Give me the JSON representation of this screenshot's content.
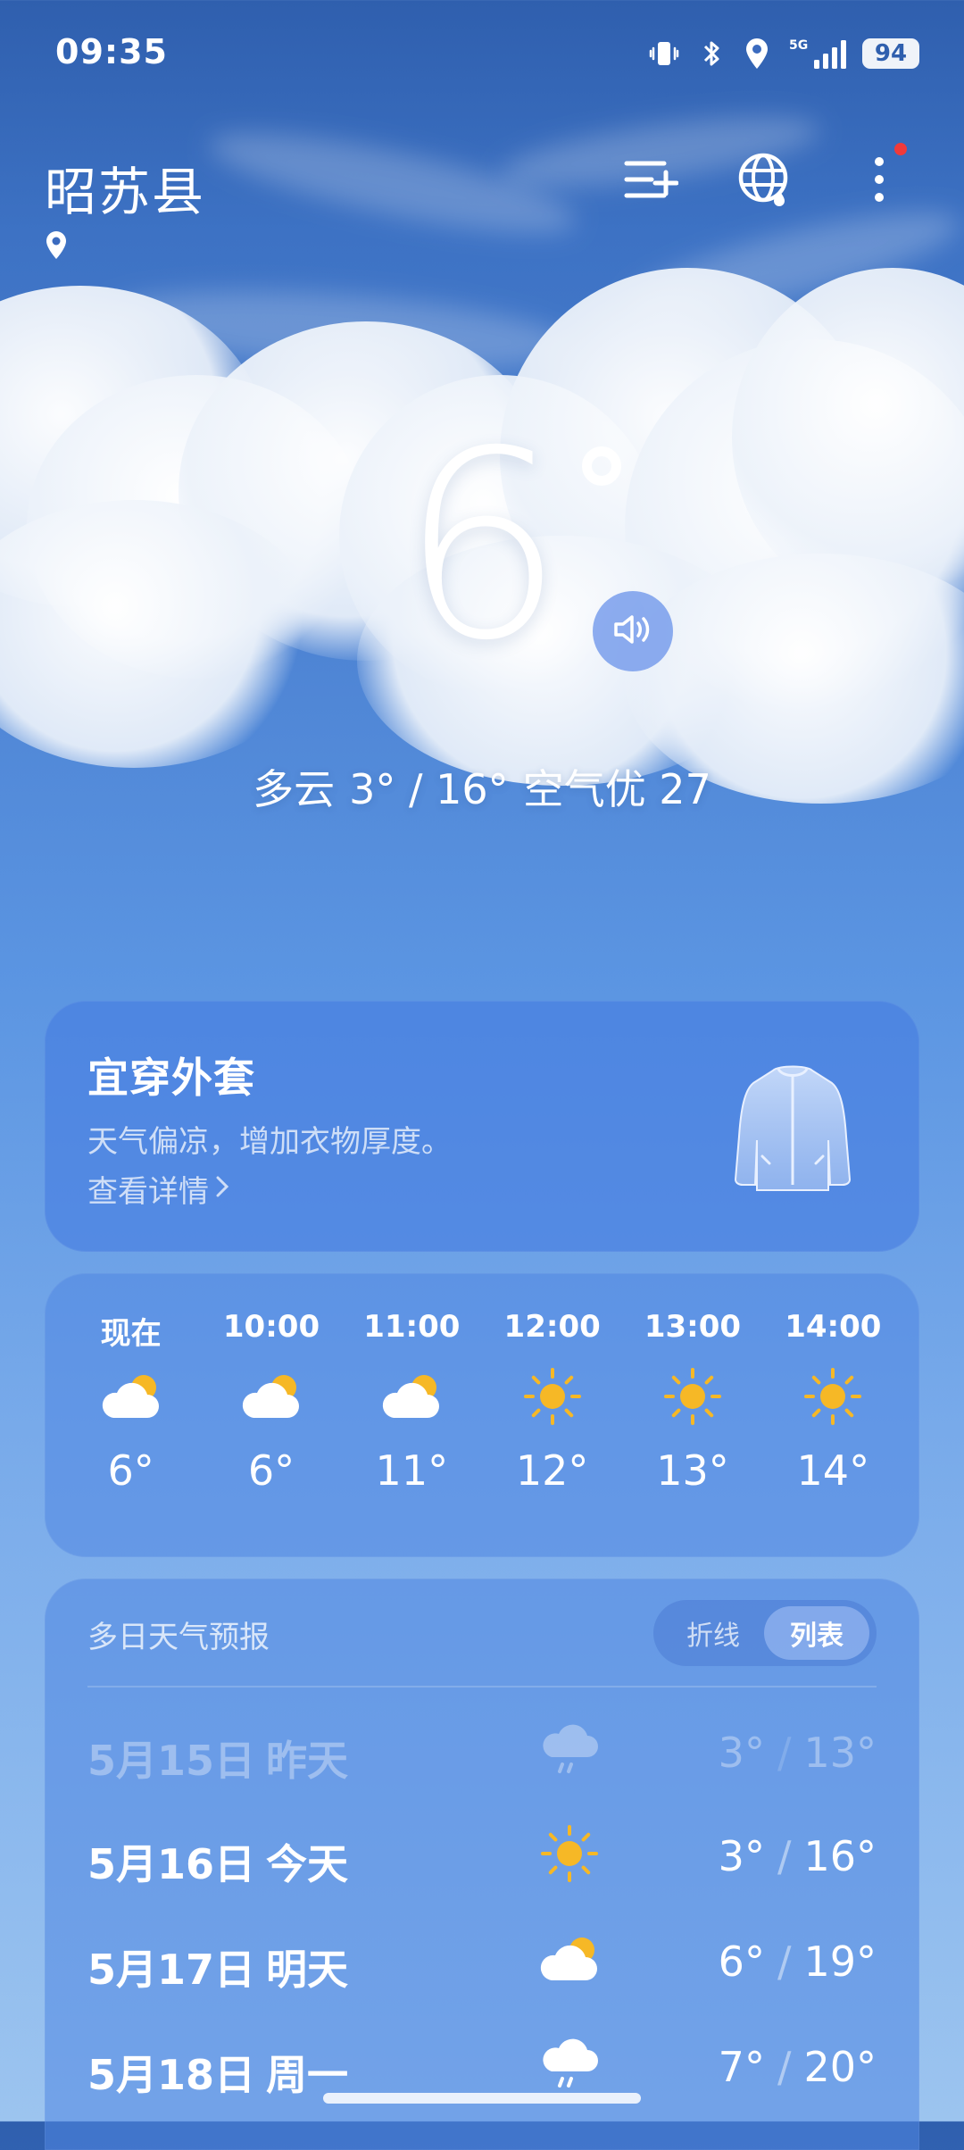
{
  "status_bar": {
    "time": "09:35",
    "network": "5G",
    "battery": "94",
    "icons": [
      "vibrate-icon",
      "bluetooth-icon",
      "location-icon",
      "signal-5g-icon",
      "battery-icon"
    ]
  },
  "header": {
    "city": "昭苏县",
    "actions": [
      "city-manage-icon",
      "globe-icon",
      "more-icon"
    ]
  },
  "current": {
    "temperature": "6",
    "condition": "多云",
    "range": "3° / 16°",
    "air_quality": "空气优 27"
  },
  "clothing_card": {
    "title": "宜穿外套",
    "description": "天气偏凉，增加衣物厚度。",
    "link_label": "查看详情"
  },
  "hourly": [
    {
      "time": "现在",
      "icon": "partly-cloudy",
      "temp": "6°"
    },
    {
      "time": "10:00",
      "icon": "partly-cloudy",
      "temp": "6°"
    },
    {
      "time": "11:00",
      "icon": "partly-cloudy",
      "temp": "11°"
    },
    {
      "time": "12:00",
      "icon": "sunny",
      "temp": "12°"
    },
    {
      "time": "13:00",
      "icon": "sunny",
      "temp": "13°"
    },
    {
      "time": "14:00",
      "icon": "sunny",
      "temp": "14°"
    }
  ],
  "daily": {
    "title": "多日天气预报",
    "toggle": {
      "line": "折线",
      "list": "列表"
    },
    "days": [
      {
        "date": "5月15日",
        "name": "昨天",
        "icon": "rain",
        "low": "3°",
        "high": "13°"
      },
      {
        "date": "5月16日",
        "name": "今天",
        "icon": "sunny",
        "low": "3°",
        "high": "16°"
      },
      {
        "date": "5月17日",
        "name": "明天",
        "icon": "partly-cloudy",
        "low": "6°",
        "high": "19°"
      },
      {
        "date": "5月18日",
        "name": "周一",
        "icon": "rain",
        "low": "7°",
        "high": "20°"
      }
    ]
  },
  "colors": {
    "accent": "#4d83d3",
    "sun": "#f6b826",
    "notification_dot": "#f03a3a"
  }
}
